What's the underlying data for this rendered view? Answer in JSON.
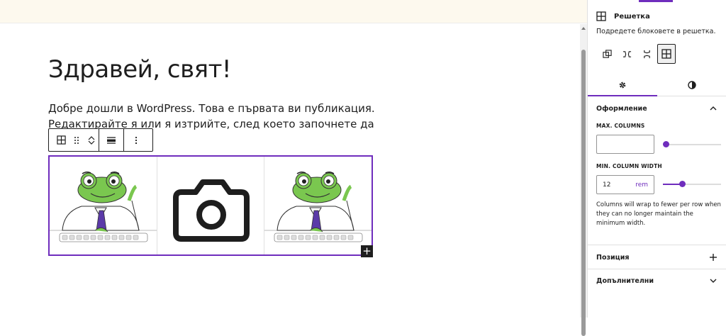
{
  "editor": {
    "post_title": "Здравей, свят!",
    "post_paragraph": "Добре дошли в WordPress. Това е първата ви публикация. Редактирайте я или я изтрийте, след което започнете да"
  },
  "block_toolbar": {
    "items": [
      "grid-icon",
      "drag-handle-icon",
      "move-up-icon",
      "move-down-icon",
      "align-icon",
      "more-options-icon"
    ]
  },
  "grid_block": {
    "cells": [
      "frog-mascot-image",
      "camera-placeholder",
      "frog-mascot-image"
    ],
    "add_label": "+"
  },
  "sidebar": {
    "block": {
      "title": "Решетка",
      "description": "Подредете блоковете в решетка.",
      "variations": [
        "group-icon",
        "row-icon",
        "stack-icon",
        "grid-icon"
      ],
      "active_variation": "grid-icon"
    },
    "tabs": [
      "settings-gear-icon",
      "styles-contrast-icon"
    ],
    "active_tab": "settings-gear-icon",
    "layout_panel": {
      "title": "Оформление",
      "max_columns_label": "MAX. COLUMNS",
      "max_columns_value": "",
      "max_columns_slider": 0.0,
      "min_width_label": "MIN. COLUMN WIDTH",
      "min_width_value": "12",
      "min_width_unit": "rem",
      "min_width_slider": 0.33,
      "help": "Columns will wrap to fewer per row when they can no longer maintain the minimum width."
    },
    "position_panel": {
      "title": "Позиция"
    },
    "advanced_panel": {
      "title": "Допълнителни"
    }
  },
  "colors": {
    "accent": "#6f2dbd",
    "text": "#1e1e1e",
    "top_band": "#fdf9ee"
  }
}
